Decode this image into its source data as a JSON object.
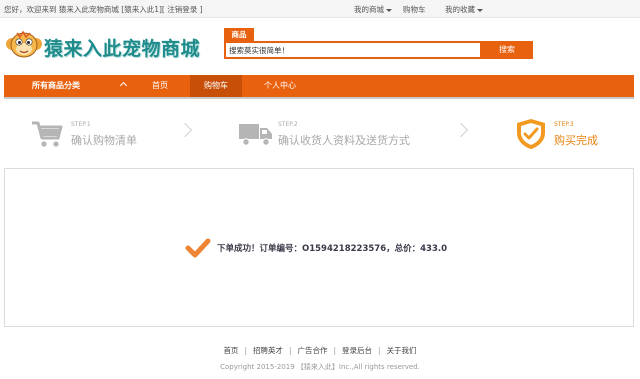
{
  "topbar": {
    "welcome_prefix": "您好，欢迎来到",
    "site_name": "猿来入此宠物商城",
    "user_label": "[猿来入此1]",
    "logout_label": "[ 注销登录 ]",
    "my_mall": "我的商城",
    "cart": "购物车",
    "favorites": "我的收藏"
  },
  "header": {
    "logo_text": "猿来入此宠物商城",
    "search_tab": "商品",
    "search_value": "搜索莫实很简单！",
    "search_button": "搜索"
  },
  "nav": {
    "category": "所有商品分类",
    "items": [
      "首页",
      "购物车",
      "个人中心"
    ]
  },
  "steps": [
    {
      "label": "STEP.1",
      "text": "确认购物清单",
      "icon": "cart-icon"
    },
    {
      "label": "STEP.2",
      "text": "确认收货人资料及送货方式",
      "icon": "truck-icon"
    },
    {
      "label": "STEP.3",
      "text": "购买完成",
      "icon": "shield-check-icon"
    }
  ],
  "result": {
    "message": "下单成功！订单编号：O1594218223576，总价：433.0"
  },
  "footer": {
    "links": [
      "首页",
      "招聘英才",
      "广告合作",
      "登录后台",
      "关于我们"
    ],
    "copyright": "Copyright 2015-2019 【猿来入此】Inc.,All rights reserved."
  },
  "colors": {
    "accent": "#e8610f",
    "accent_dark": "#c84f08",
    "step_done": "#e8830f",
    "logo_teal": "#1f8b8b"
  }
}
